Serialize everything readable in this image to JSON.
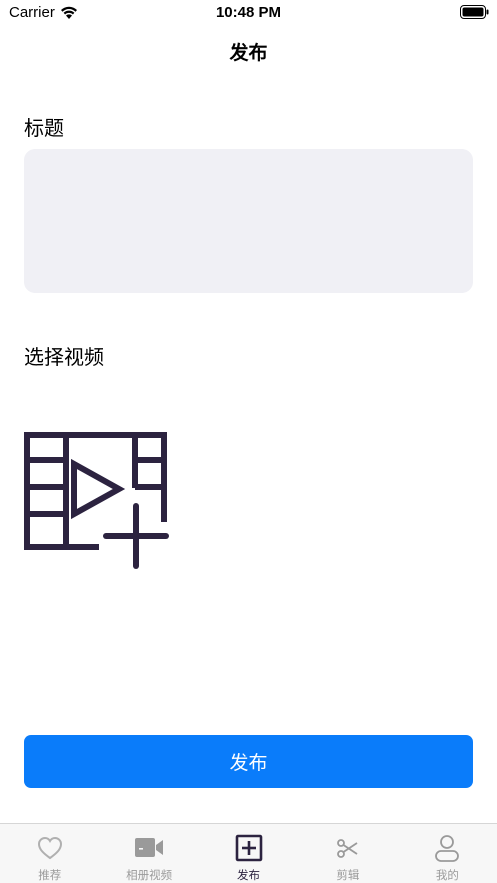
{
  "status_bar": {
    "carrier": "Carrier",
    "time": "10:48 PM"
  },
  "nav": {
    "title": "发布"
  },
  "form": {
    "title_label": "标题",
    "title_value": "",
    "video_label": "选择视频",
    "add_video_icon": "video-add-icon"
  },
  "publish_button": {
    "label": "发布",
    "color": "#0a7cfa"
  },
  "tab_bar": {
    "active_index": 2,
    "active_color": "#2c2340",
    "inactive_color": "#9a9a9a",
    "items": [
      {
        "label": "推荐",
        "icon": "heart-icon"
      },
      {
        "label": "相册视频",
        "icon": "video-camera-icon"
      },
      {
        "label": "发布",
        "icon": "plus-square-icon"
      },
      {
        "label": "剪辑",
        "icon": "scissors-icon"
      },
      {
        "label": "我的",
        "icon": "person-icon"
      }
    ]
  }
}
